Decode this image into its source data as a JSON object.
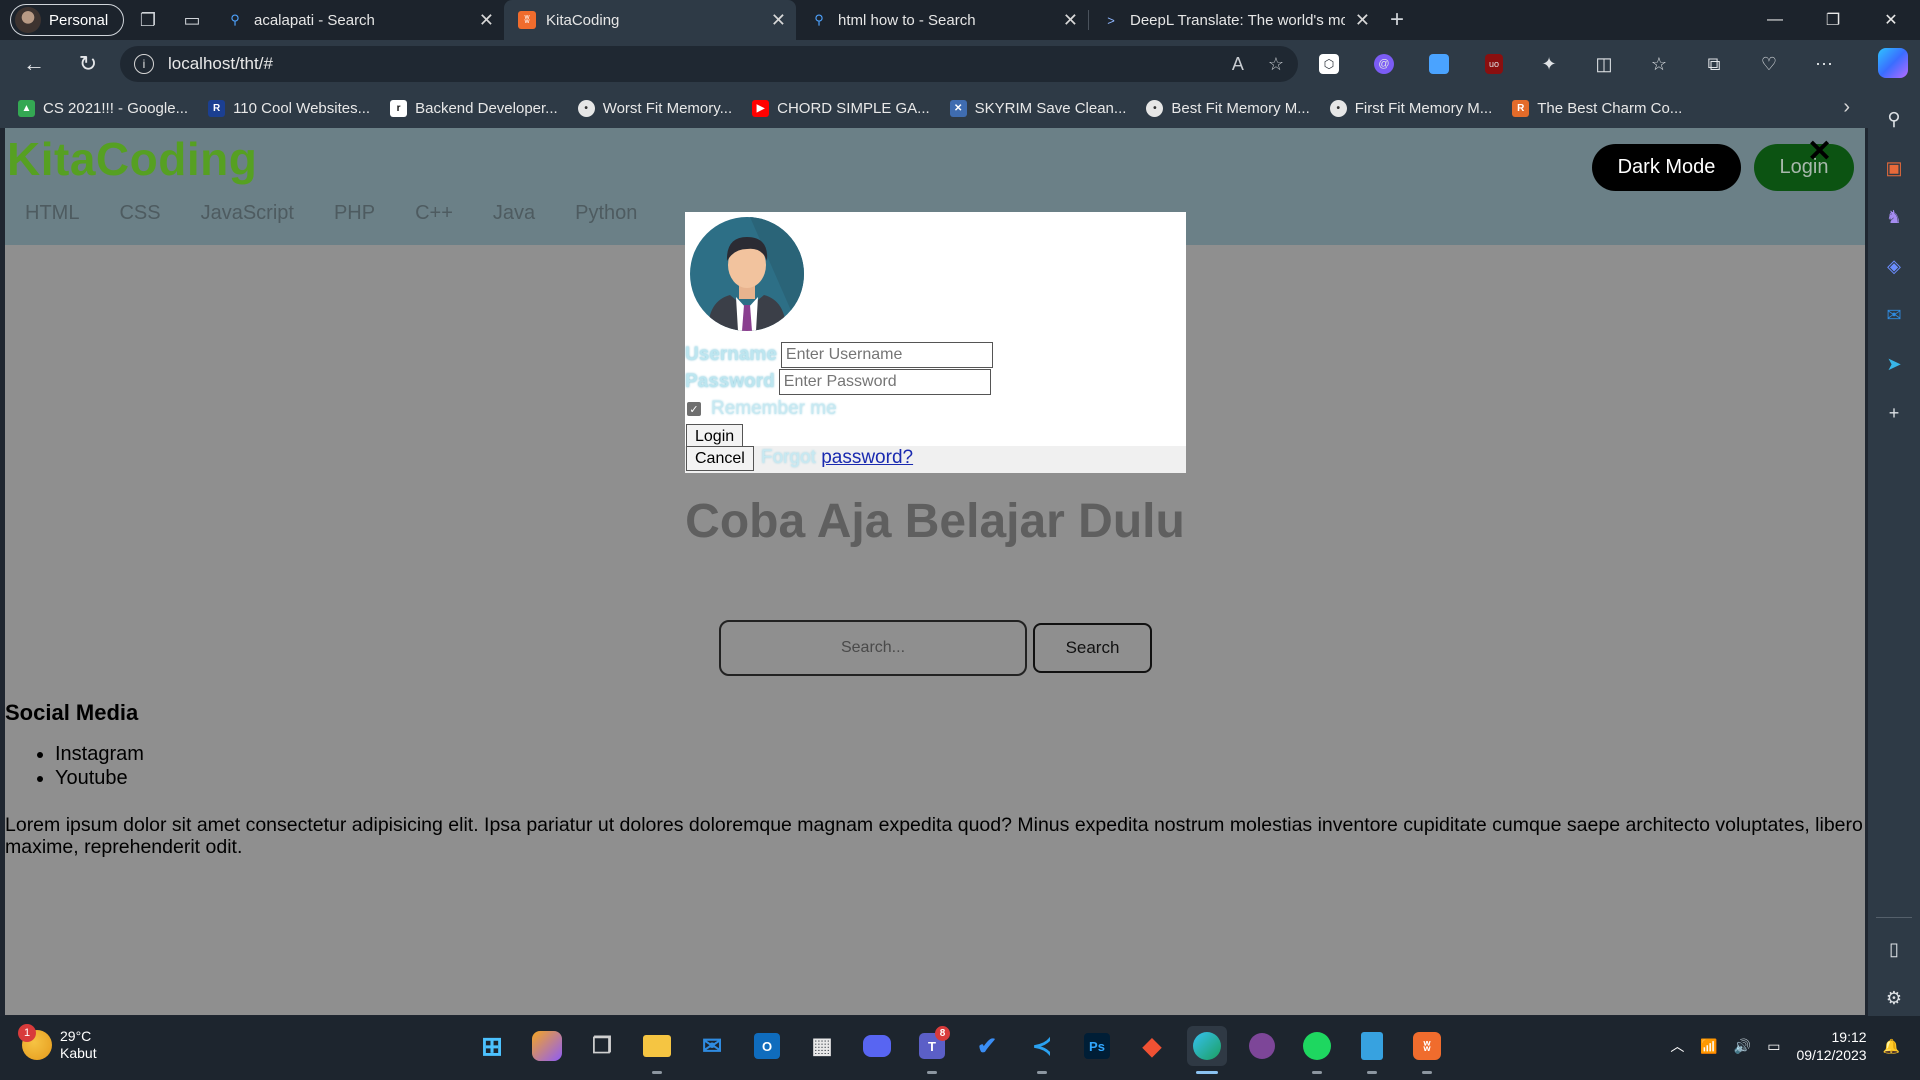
{
  "browser": {
    "profile_label": "Personal",
    "tabs": [
      {
        "title": "acalapati - Search",
        "icon": "search-icon",
        "active": false
      },
      {
        "title": "KitaCoding",
        "icon": "xampp-icon",
        "active": true
      },
      {
        "title": "html how to - Search",
        "icon": "search-icon",
        "active": false
      },
      {
        "title": "DeepL Translate: The world's most",
        "icon": "deepl-icon",
        "active": false
      }
    ],
    "url": "localhost/tht/#",
    "bookmarks": [
      {
        "label": "CS 2021!!! - Google...",
        "color": "#34a853"
      },
      {
        "label": "110 Cool Websites...",
        "color": "#1b3f91"
      },
      {
        "label": "Backend Developer...",
        "color": "#111111"
      },
      {
        "label": "Worst Fit Memory...",
        "color": "#e6e6e6"
      },
      {
        "label": "CHORD SIMPLE GA...",
        "color": "#ff0000"
      },
      {
        "label": "SKYRIM Save Clean...",
        "color": "#3f6cb0"
      },
      {
        "label": "Best Fit Memory M...",
        "color": "#e6e6e6"
      },
      {
        "label": "First Fit Memory M...",
        "color": "#e6e6e6"
      },
      {
        "label": "The Best Charm Co...",
        "color": "#e36b2a"
      }
    ]
  },
  "site": {
    "logo": "KitaCoding",
    "nav": [
      "HTML",
      "CSS",
      "JavaScript",
      "PHP",
      "C++",
      "Java",
      "Python"
    ],
    "dark_mode_label": "Dark Mode",
    "login_label": "Login",
    "close_symbol": "✕",
    "hero_title": "Coba Aja Belajar Dulu",
    "search_placeholder": "Search...",
    "search_button": "Search",
    "social_heading": "Social Media",
    "social_links": [
      "Instagram",
      "Youtube"
    ],
    "lorem": "Lorem ipsum dolor sit amet consectetur adipisicing elit. Ipsa pariatur ut dolores doloremque magnam expedita quod? Minus expedita nostrum molestias inventore cupiditate cumque saepe architecto voluptates, libero maxime, reprehenderit odit."
  },
  "modal": {
    "username_label": "Username",
    "username_placeholder": "Enter Username",
    "password_label": "Password",
    "password_placeholder": "Enter Password",
    "remember_label": "Remember me",
    "remember_checked": true,
    "login_button": "Login",
    "cancel_button": "Cancel",
    "forgot_text": "Forgot",
    "forgot_link": "password?"
  },
  "taskbar": {
    "weather_temp": "29°C",
    "weather_desc": "Kabut",
    "weather_badge": "1",
    "teams_badge": "8",
    "time": "19:12",
    "date": "09/12/2023"
  },
  "colors": {
    "header_bg": "#6b8087",
    "logo_green": "#56a022",
    "page_bg": "#8f8f8f",
    "login_green": "#0c5312"
  }
}
